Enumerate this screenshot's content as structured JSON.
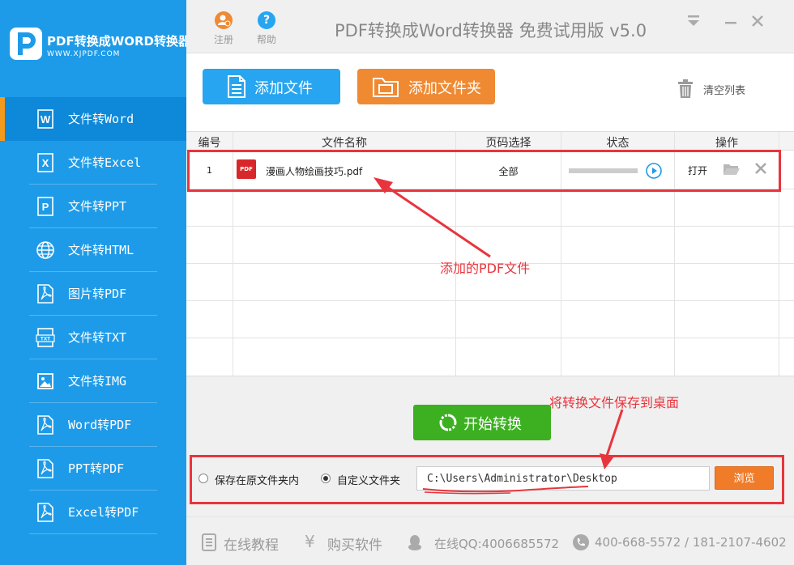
{
  "app": {
    "logo_title": "PDF转换成WORD转换器",
    "logo_url": "WWW.XJPDF.COM",
    "title": "PDF转换成Word转换器 免费试用版 v5.0",
    "register_label": "注册",
    "help_label": "帮助"
  },
  "sidebar": {
    "items": [
      {
        "label": "文件转Word",
        "icon": "word-icon",
        "glyph": "W"
      },
      {
        "label": "文件转Excel",
        "icon": "excel-icon",
        "glyph": "X"
      },
      {
        "label": "文件转PPT",
        "icon": "ppt-icon",
        "glyph": "P"
      },
      {
        "label": "文件转HTML",
        "icon": "globe-icon",
        "glyph": "⊕"
      },
      {
        "label": "图片转PDF",
        "icon": "pdf-icon",
        "glyph": "⅄"
      },
      {
        "label": "文件转TXT",
        "icon": "txt-icon",
        "glyph": "TXT"
      },
      {
        "label": "文件转IMG",
        "icon": "image-icon",
        "glyph": "▣"
      },
      {
        "label": "Word转PDF",
        "icon": "pdf-icon",
        "glyph": "⅄"
      },
      {
        "label": "PPT转PDF",
        "icon": "pdf-icon",
        "glyph": "⅄"
      },
      {
        "label": "Excel转PDF",
        "icon": "pdf-icon",
        "glyph": "⅄"
      }
    ]
  },
  "toolbar": {
    "add_file_label": "添加文件",
    "add_folder_label": "添加文件夹",
    "clear_list_label": "清空列表"
  },
  "table": {
    "headers": [
      "编号",
      "文件名称",
      "页码选择",
      "状态",
      "操作"
    ],
    "rows": [
      {
        "index": "1",
        "file_badge": "PDF",
        "filename": "漫画人物绘画技巧.pdf",
        "pages": "全部",
        "progress": 0,
        "open_label": "打开"
      }
    ]
  },
  "annotations": {
    "added_pdf": "添加的PDF文件",
    "save_to_desktop": "将转换文件保存到桌面"
  },
  "convert": {
    "start_label": "开始转换",
    "save_original_label": "保存在原文件夹内",
    "custom_folder_label": "自定义文件夹",
    "selected_option": "custom",
    "path_value": "C:\\Users\\Administrator\\Desktop",
    "browse_label": "浏览"
  },
  "footer": {
    "tutorial_label": "在线教程",
    "buy_label": "购买软件",
    "qq_label": "在线QQ:4006685572",
    "phone_label": "400-668-5572 / 181-2107-4602"
  },
  "colors": {
    "sidebar": "#1e9be8",
    "accent_orange": "#f39a1e",
    "add_file_blue": "#27a5f0",
    "add_folder_orange": "#ef8a33",
    "start_green": "#3cb021",
    "annotation_red": "#e8353d"
  }
}
